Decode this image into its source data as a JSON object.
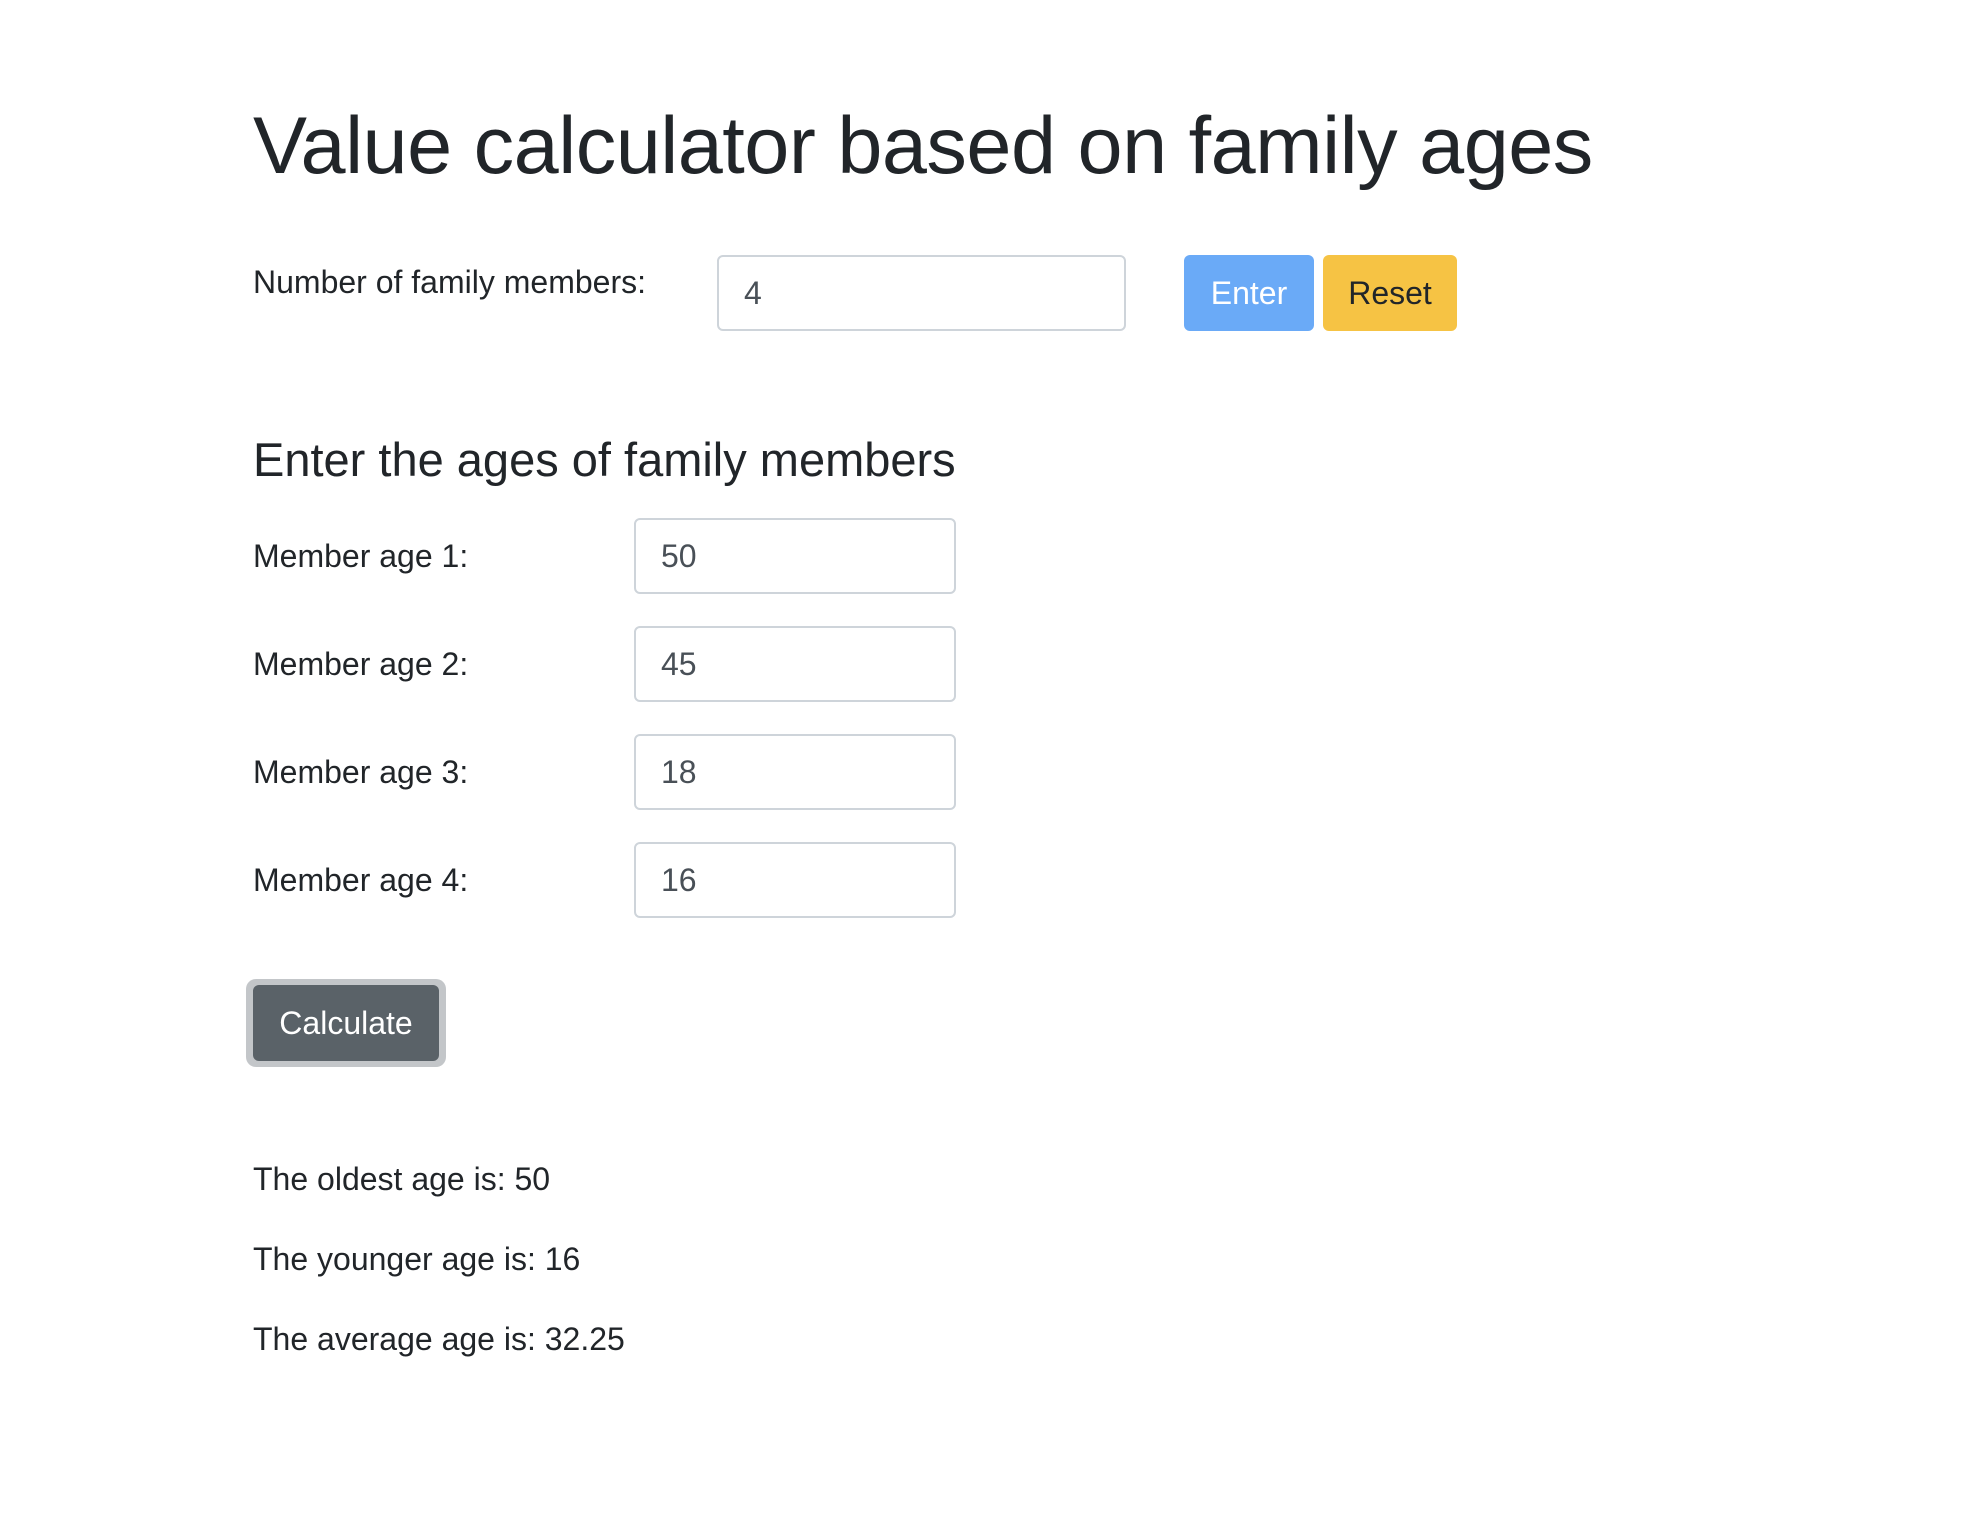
{
  "page": {
    "title": "Value calculator based on family ages"
  },
  "family": {
    "count_label": "Number of family members:",
    "count_value": "4",
    "enter_label": "Enter",
    "reset_label": "Reset"
  },
  "members": {
    "heading": "Enter the ages of family members",
    "items": [
      {
        "label": "Member age 1:",
        "value": "50"
      },
      {
        "label": "Member age 2:",
        "value": "45"
      },
      {
        "label": "Member age 3:",
        "value": "18"
      },
      {
        "label": "Member age 4:",
        "value": "16"
      }
    ],
    "calculate_label": "Calculate"
  },
  "results": {
    "oldest": "The oldest age is: 50",
    "youngest": "The younger age is: 16",
    "average": "The average age is: 32.25"
  },
  "colors": {
    "enter_button": "#6aaaf7",
    "reset_button": "#f6c344",
    "calculate_button": "#5a6268",
    "text": "#212529"
  }
}
